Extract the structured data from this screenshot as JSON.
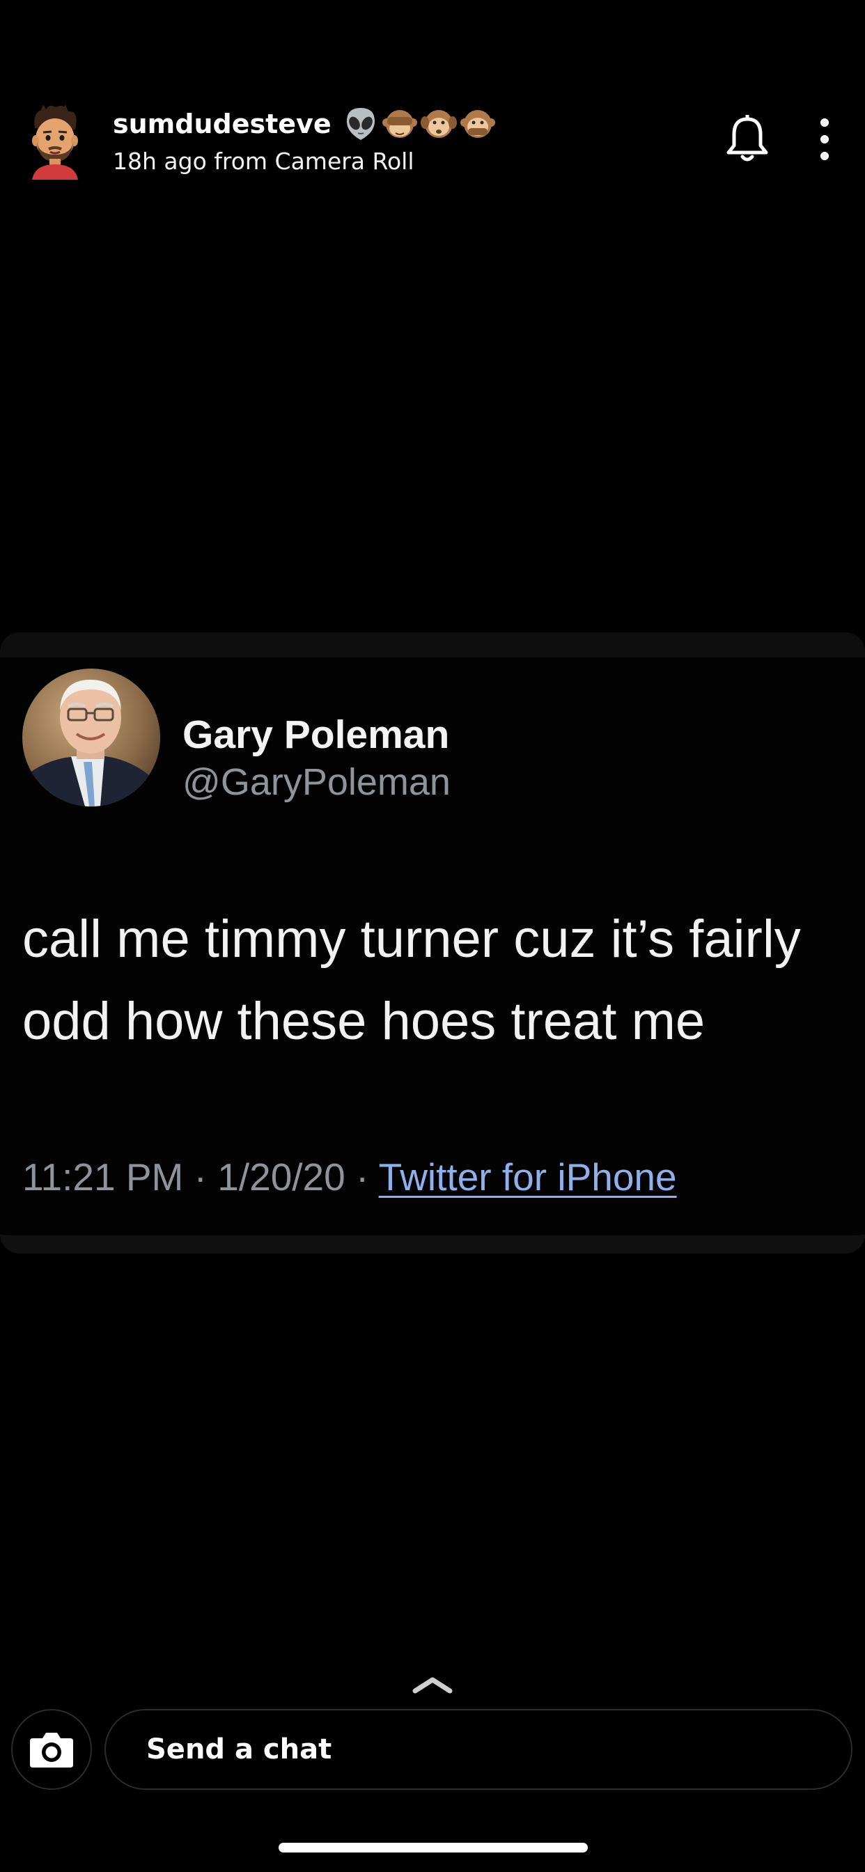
{
  "story": {
    "username": "sumdudesteve",
    "emojis": [
      "alien-emoji",
      "see-no-evil-monkey-emoji",
      "hear-no-evil-monkey-emoji",
      "speak-no-evil-monkey-emoji"
    ],
    "subtitle": "18h ago from Camera Roll",
    "icons": {
      "notification": "bell-icon",
      "more": "vertical-ellipsis-icon"
    }
  },
  "tweet": {
    "display_name": "Gary Poleman",
    "handle": "@GaryPoleman",
    "text": "call me timmy turner cuz it’s fairly odd how these hoes treat me",
    "time": "11:21 PM",
    "separator": " · ",
    "date": "1/20/20",
    "source": "Twitter for iPhone"
  },
  "chat_bar": {
    "placeholder": "Send a chat",
    "icons": {
      "camera": "camera-icon",
      "swipe_up": "chevron-up-icon"
    }
  },
  "colors": {
    "background": "#000000",
    "handle_gray": "#8e949a",
    "link_blue": "#8fb0ea"
  }
}
